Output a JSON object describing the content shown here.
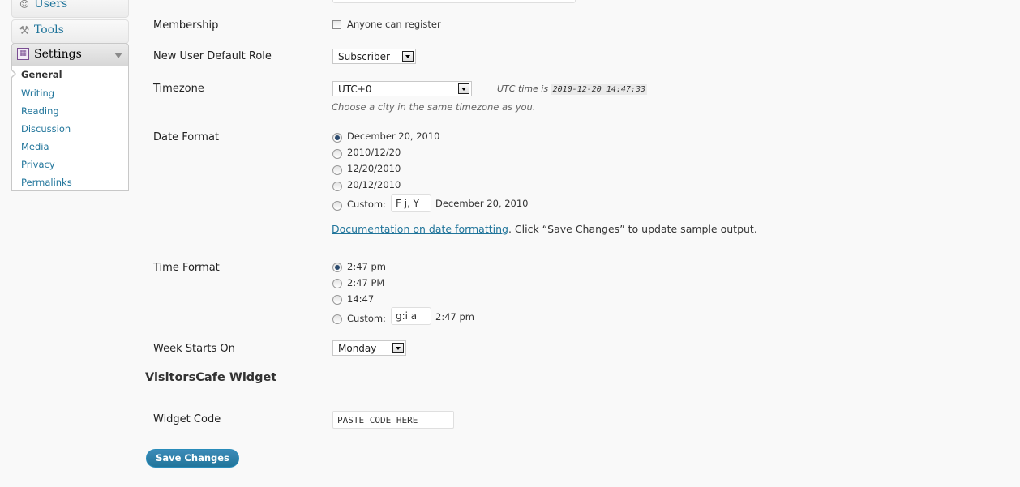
{
  "sidebar": {
    "users_label": "Users",
    "tools_label": "Tools",
    "settings_label": "Settings",
    "submenu": [
      "General",
      "Writing",
      "Reading",
      "Discussion",
      "Media",
      "Privacy",
      "Permalinks"
    ]
  },
  "form": {
    "membership": {
      "label": "Membership",
      "checkbox_label": "Anyone can register",
      "checked": false
    },
    "default_role": {
      "label": "New User Default Role",
      "value": "Subscriber"
    },
    "timezone": {
      "label": "Timezone",
      "value": "UTC+0",
      "utc_prefix": "UTC time is",
      "utc_value": "2010-12-20 14:47:33",
      "hint": "Choose a city in the same timezone as you."
    },
    "date_format": {
      "label": "Date Format",
      "options": [
        "December 20, 2010",
        "2010/12/20",
        "12/20/2010",
        "20/12/2010"
      ],
      "selected": "December 20, 2010",
      "custom_label": "Custom:",
      "custom_value": "F j, Y",
      "custom_preview": "December 20, 2010",
      "doc_link": "Documentation on date formatting",
      "doc_text": ". Click “Save Changes” to update sample output."
    },
    "time_format": {
      "label": "Time Format",
      "options": [
        "2:47 pm",
        "2:47 PM",
        "14:47"
      ],
      "selected": "2:47 pm",
      "custom_label": "Custom:",
      "custom_value": "g:i a",
      "custom_preview": "2:47 pm"
    },
    "week_start": {
      "label": "Week Starts On",
      "value": "Monday"
    }
  },
  "widget_section": {
    "title": "VisitorsCafe Widget",
    "code_label": "Widget Code",
    "code_value": "PASTE CODE HERE"
  },
  "save_button": "Save Changes"
}
